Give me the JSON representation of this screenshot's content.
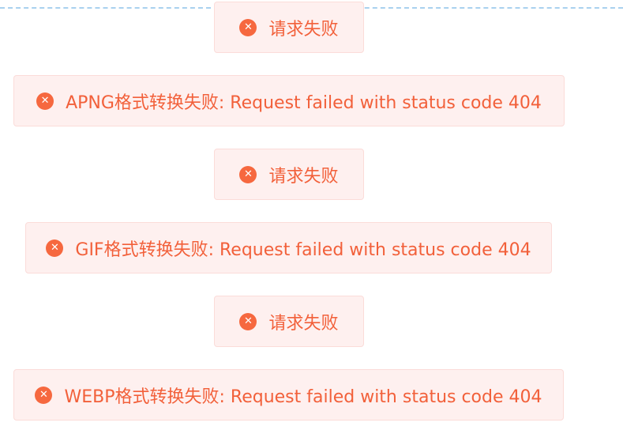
{
  "icons": {
    "error": "error-circle-x-icon"
  },
  "icon_glyph": "✕",
  "colors": {
    "toast_background": "#fef0ef",
    "toast_border": "#fbdcd9",
    "toast_text": "#f2603a",
    "icon_fill": "#f6683f",
    "dashed_line": "#a9d1ef"
  },
  "toasts": [
    {
      "message": "请求失败"
    },
    {
      "message": "APNG格式转换失败: Request failed with status code 404"
    },
    {
      "message": "请求失败"
    },
    {
      "message": "GIF格式转换失败: Request failed with status code 404"
    },
    {
      "message": "请求失败"
    },
    {
      "message": "WEBP格式转换失败: Request failed with status code 404"
    }
  ]
}
